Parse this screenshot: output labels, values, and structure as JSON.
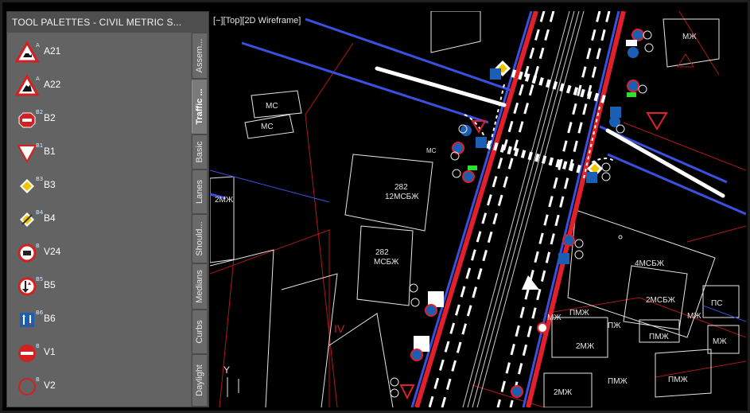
{
  "palette": {
    "title": "TOOL PALETTES - CIVIL METRIC S...",
    "items": [
      {
        "label": "A21",
        "badge": "A",
        "icon": "warning-triangle-animals-icon"
      },
      {
        "label": "A22",
        "badge": "A",
        "icon": "warning-triangle-deer-icon"
      },
      {
        "label": "B2",
        "badge": "B2",
        "icon": "stop-sign-icon"
      },
      {
        "label": "B1",
        "badge": "B1",
        "icon": "yield-triangle-icon"
      },
      {
        "label": "B3",
        "badge": "B3",
        "icon": "priority-road-diamond-icon"
      },
      {
        "label": "B4",
        "badge": "B4",
        "icon": "end-priority-road-icon"
      },
      {
        "label": "V24",
        "badge": "B",
        "icon": "no-entry-truck-icon"
      },
      {
        "label": "B5",
        "badge": "B5",
        "icon": "give-way-oncoming-icon"
      },
      {
        "label": "B6",
        "badge": "B6",
        "icon": "priority-over-oncoming-icon"
      },
      {
        "label": "V1",
        "badge": "B",
        "icon": "no-entry-icon"
      },
      {
        "label": "V2",
        "badge": "B",
        "icon": "closed-to-traffic-icon"
      }
    ],
    "tabs": [
      "Assem...",
      "Traffic ...",
      "Basic",
      "Lanes",
      "Should...",
      "Medians",
      "Curbs",
      "Daylight"
    ],
    "active_tab": "Traffic ..."
  },
  "viewport": {
    "label": "[−][Top][2D Wireframe]",
    "ucs_y": "Y",
    "annotations": {
      "mzh_top": "МЖ",
      "ms1": "МС",
      "ms2": "МС",
      "ms_small": "МС",
      "b282a_num": "282",
      "b282a_code": "12МСБЖ",
      "b282b_num": "282",
      "b282b_code": "МСБЖ",
      "mzh_left": "2МЖ",
      "roman": "IV",
      "b4": "4МСБЖ",
      "b2msbzh": "2МСБЖ",
      "ps": "ПС",
      "mzh_r": "МЖ",
      "mzh_r2": "МЖ",
      "pmzh1": "ПМЖ",
      "pmzh2": "ПМЖ",
      "mzh_mid": "МЖ",
      "pzh": "ПЖ",
      "m2zh_a": "2МЖ",
      "pmzh3": "ПМЖ",
      "pmzh4": "ПМЖ",
      "m2zh_b": "2МЖ"
    }
  },
  "colors": {
    "panel": "#5f5f5f",
    "road_red": "#e0202a",
    "road_blue": "#3b4fe0",
    "sign_blue": "#1a5fb4"
  }
}
